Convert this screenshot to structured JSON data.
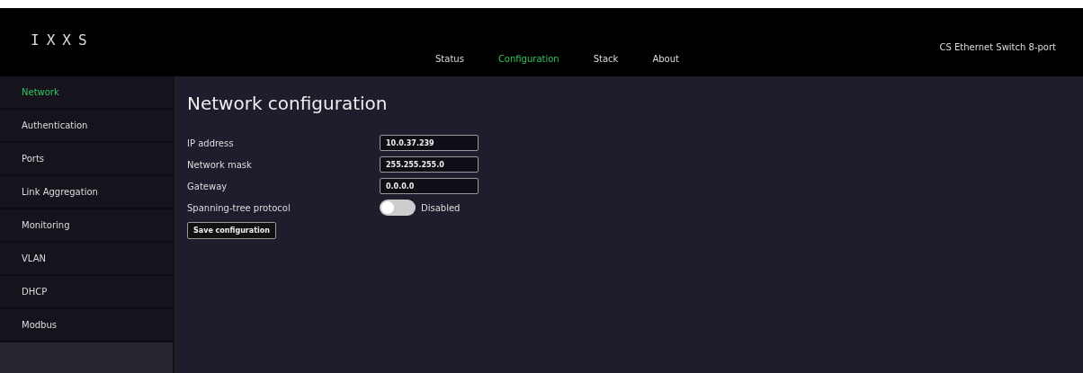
{
  "header": {
    "logo": "IXXS",
    "device_name": "CS Ethernet Switch 8-port"
  },
  "nav": [
    {
      "label": "Status",
      "selected": false
    },
    {
      "label": "Configuration",
      "selected": true
    },
    {
      "label": "Stack",
      "selected": false
    },
    {
      "label": "About",
      "selected": false
    }
  ],
  "sidebar": {
    "items": [
      {
        "label": "Network",
        "selected": true
      },
      {
        "label": "Authentication",
        "selected": false
      },
      {
        "label": "Ports",
        "selected": false
      },
      {
        "label": "Link Aggregation",
        "selected": false
      },
      {
        "label": "Monitoring",
        "selected": false
      },
      {
        "label": "VLAN",
        "selected": false
      },
      {
        "label": "DHCP",
        "selected": false
      },
      {
        "label": "Modbus",
        "selected": false
      }
    ]
  },
  "page": {
    "title": "Network configuration",
    "fields": [
      {
        "kind": "text",
        "label": "IP address",
        "value": "10.0.37.239"
      },
      {
        "kind": "text",
        "label": "Network mask",
        "value": "255.255.255.0"
      },
      {
        "kind": "text",
        "label": "Gateway",
        "value": "0.0.0.0"
      },
      {
        "kind": "toggle",
        "label": "Spanning-tree protocol",
        "on": false,
        "state_text": "Disabled"
      }
    ],
    "save_button": "Save configuration"
  }
}
